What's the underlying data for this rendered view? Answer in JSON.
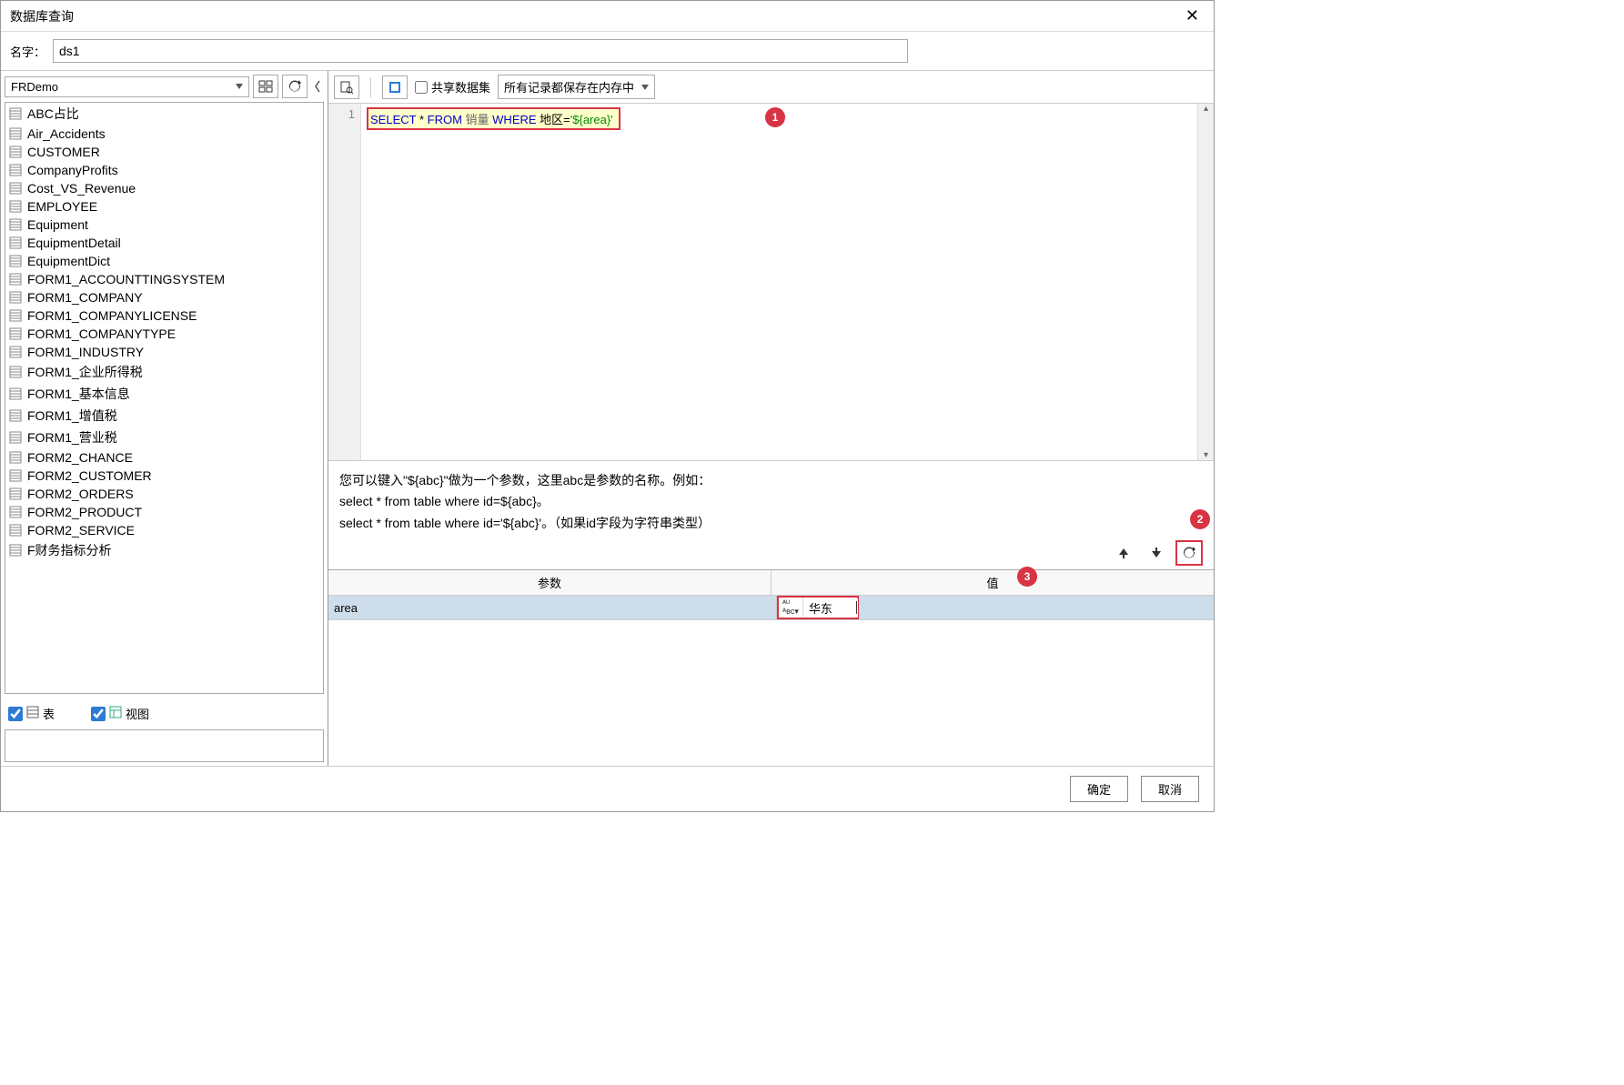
{
  "dialog_title": "数据库查询",
  "name_label": "名字：",
  "name_value": "ds1",
  "connection": "FRDemo",
  "tables": [
    "ABC占比",
    "Air_Accidents",
    "CUSTOMER",
    "CompanyProfits",
    "Cost_VS_Revenue",
    "EMPLOYEE",
    "Equipment",
    "EquipmentDetail",
    "EquipmentDict",
    "FORM1_ACCOUNTTINGSYSTEM",
    "FORM1_COMPANY",
    "FORM1_COMPANYLICENSE",
    "FORM1_COMPANYTYPE",
    "FORM1_INDUSTRY",
    "FORM1_企业所得税",
    "FORM1_基本信息",
    "FORM1_增值税",
    "FORM1_营业税",
    "FORM2_CHANCE",
    "FORM2_CUSTOMER",
    "FORM2_ORDERS",
    "FORM2_PRODUCT",
    "FORM2_SERVICE",
    "F财务指标分析"
  ],
  "chk_table_label": "表",
  "chk_view_label": "视图",
  "chk_table": true,
  "chk_view": true,
  "share_label": "共享数据集",
  "memory_option": "所有记录都保存在内存中",
  "line_no": "1",
  "sql": {
    "kw_select": "SELECT",
    "star": " * ",
    "kw_from": "FROM",
    "tbl": " 销量 ",
    "kw_where": "WHERE",
    "col": " 地区=",
    "str": "'${area}'"
  },
  "hint_line1": "您可以键入\"${abc}\"做为一个参数，这里abc是参数的名称。例如：",
  "hint_line2": "select * from table where id=${abc}。",
  "hint_line3": "select * from table where id='${abc}'。（如果id字段为字符串类型）",
  "param_header_name": "参数",
  "param_header_value": "值",
  "param_name": "area",
  "param_value": "华东",
  "ok_label": "确定",
  "cancel_label": "取消",
  "badge1": "1",
  "badge2": "2",
  "badge3": "3"
}
